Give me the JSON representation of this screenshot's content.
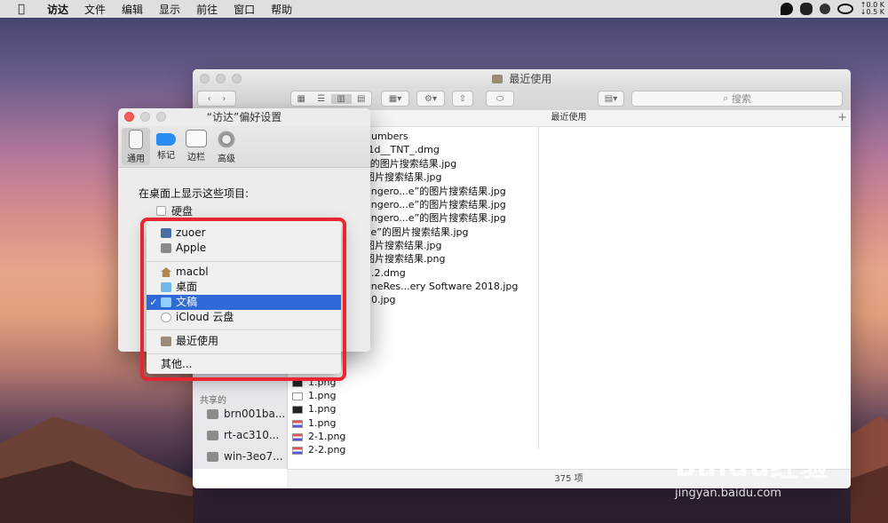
{
  "menubar": {
    "app": "访达",
    "items": [
      "文件",
      "编辑",
      "显示",
      "前往",
      "窗口",
      "帮助"
    ],
    "net_up": "0.0 K",
    "net_down": "0.5 K"
  },
  "finder": {
    "title": "最近使用",
    "search_placeholder": "搜索",
    "column_header": "最近使用",
    "add_column": "+",
    "files": [
      "numbers",
      ".1d__TNT_.dmg",
      "”的图片搜索结果.jpg",
      "图片搜索结果.jpg",
      "angero...e”的图片搜索结果.jpg",
      "angero...e”的图片搜索结果.jpg",
      "angero...e”的图片搜索结果.jpg",
      "ve”的图片搜索结果.jpg",
      "图片搜索结果.jpg",
      "图片搜索结果.png",
      "1.2.dmg",
      "oneRes...ery Software 2018.jpg",
      "50.jpg"
    ],
    "files_lower": [
      "1.png",
      "1.png",
      "1.png",
      "1.png",
      "2-1.png",
      "2-2.png"
    ],
    "sidebar": {
      "shared_label": "共享的",
      "shared": [
        "brn001ba...",
        "rt-ac310...",
        "win-3eo7..."
      ]
    },
    "status": "375 项"
  },
  "prefs": {
    "title": "“访达”偏好设置",
    "tabs": [
      {
        "label": "通用",
        "selected": true
      },
      {
        "label": "标记",
        "selected": false
      },
      {
        "label": "边栏",
        "selected": false
      },
      {
        "label": "高级",
        "selected": false
      }
    ],
    "desktop_label": "在桌面上显示这些项目:",
    "hard_disk": "硬盘"
  },
  "popup": {
    "items": [
      {
        "label": "zuoer",
        "icon": "computer-icon"
      },
      {
        "label": "Apple",
        "icon": "drive-icon"
      },
      {
        "label": "macbl",
        "icon": "home-icon"
      },
      {
        "label": "桌面",
        "icon": "folder-icon"
      },
      {
        "label": "文稿",
        "icon": "folder-icon",
        "selected": true
      },
      {
        "label": "iCloud 云盘",
        "icon": "cloud-icon"
      },
      {
        "label": "最近使用",
        "icon": "recents-icon"
      },
      {
        "label": "其他...",
        "icon": ""
      }
    ],
    "checkmark": "✓"
  },
  "watermark": {
    "brand": "Baidu经验",
    "url": "jingyan.baidu.com"
  },
  "colors": {
    "selection": "#2f6ad8",
    "highlight_box": "#e8262f",
    "close_button": "#fc5c57",
    "minimize_button": "#fdbc40",
    "zoom_button": "#34c84a"
  }
}
